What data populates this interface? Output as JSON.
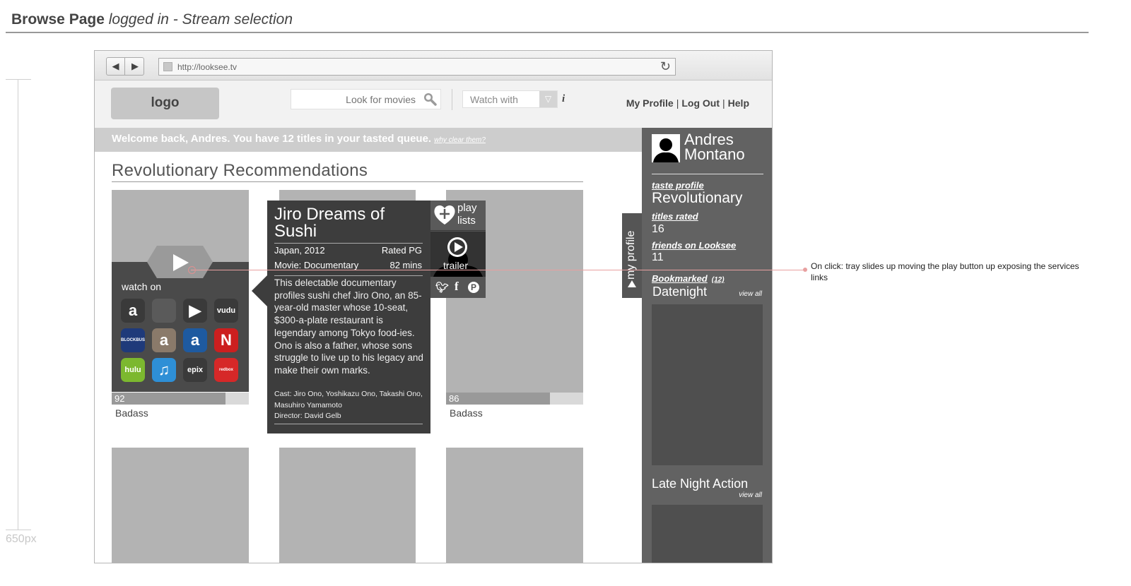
{
  "page": {
    "title_bold": "Browse Page",
    "title_italic": "logged in - Stream selection",
    "height_label": "650px"
  },
  "browser": {
    "url": "http://looksee.tv",
    "nav_back": "◀",
    "nav_forward": "▶",
    "reload_icon": "↻"
  },
  "header": {
    "logo": "logo",
    "search_placeholder": "Look for movies",
    "watch_with": "Watch with",
    "info_icon": "i",
    "links": [
      "My Profile",
      "Log Out",
      "Help"
    ]
  },
  "welcome": {
    "message": "Welcome back, Andres. You have 12 titles in your tasted queue.",
    "clear_link": "why clear them?"
  },
  "section": {
    "title": "Revolutionary Recommendations"
  },
  "cards": [
    {
      "score": "92",
      "score_fraction": 0.83,
      "genre": "Badass"
    },
    {
      "score": "86",
      "score_fraction": 0.76,
      "genre": "Badass"
    }
  ],
  "watch_tray": {
    "label": "watch on",
    "services": [
      {
        "icon": "amazon-icon",
        "text": "a",
        "color": "#3a3a3a"
      },
      {
        "icon": "apple-icon",
        "text": "",
        "color": "#5a5a5a"
      },
      {
        "icon": "google-play-icon",
        "text": "▶",
        "color": "#3a3a3a"
      },
      {
        "icon": "vudu-icon",
        "text": "vudu",
        "color": "#3a3a3a"
      },
      {
        "icon": "blockbuster-icon",
        "text": "BLOCKBUSTER",
        "color": "#1f3a7a"
      },
      {
        "icon": "amazon-dvd-icon",
        "text": "a",
        "color": "#8a7a6a"
      },
      {
        "icon": "amazon-bluray-icon",
        "text": "a",
        "color": "#1e5aa0"
      },
      {
        "icon": "netflix-icon",
        "text": "N",
        "color": "#cc1f1f"
      },
      {
        "icon": "hulu-plus-icon",
        "text": "hulu",
        "color": "#7cb82f"
      },
      {
        "icon": "itunes-icon",
        "text": "♫",
        "color": "#2e8fd6"
      },
      {
        "icon": "epix-icon",
        "text": "epix",
        "color": "#3a3a3a"
      },
      {
        "icon": "redbox-icon",
        "text": "redbox",
        "color": "#d62828"
      }
    ]
  },
  "detail": {
    "title": "Jiro Dreams of Sushi",
    "origin": "Japan, 2012",
    "rating": "Rated PG",
    "genre": "Movie: Documentary",
    "runtime": "82 mins",
    "synopsis": "This delectable documentary profiles sushi chef Jiro Ono, an 85-year-old master whose 10-seat, $300-a-plate restaurant is legendary among Tokyo food-ies. Ono is also a father, whose sons struggle to live up to his legacy and make their own marks.",
    "cast": "Cast: Jiro Ono, Yoshikazu Ono, Takashi Ono, Masuhiro Yamamoto",
    "director": "Director: David Gelb",
    "playlist_label": "play lists",
    "trailer_label": "trailer"
  },
  "profile": {
    "tab_label": "my profile",
    "name": "Andres Montano",
    "taste_label": "taste profile",
    "taste_value": "Revolutionary",
    "rated_label": "titles rated",
    "rated_value": "16",
    "friends_label": "friends on Looksee",
    "friends_value": "11",
    "bookmarked_label": "Bookmarked",
    "bookmarked_count": "(12)",
    "list1_name": "Datenight",
    "list2_name": "Late Night Action",
    "view_all": "view all"
  },
  "annotation": {
    "text": "On click: tray slides up moving the play button up exposing the services links"
  },
  "colors": {
    "panel_dark": "#3d3d3d",
    "profile_panel": "#626262",
    "poster_gray": "#b3b3b3",
    "annotation_red": "#e8a0a0"
  }
}
